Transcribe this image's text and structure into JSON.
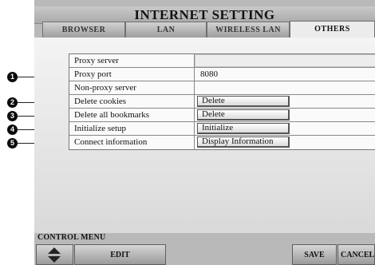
{
  "window": {
    "title": "INTERNET SETTING"
  },
  "tabs": [
    {
      "label": "BROWSER",
      "active": false
    },
    {
      "label": "LAN",
      "active": false
    },
    {
      "label": "WIRELESS LAN",
      "active": false
    },
    {
      "label": "OTHERS",
      "active": true
    }
  ],
  "settings": {
    "proxy_server": {
      "label": "Proxy server",
      "value": ""
    },
    "proxy_port": {
      "label": "Proxy port",
      "value": "8080"
    },
    "non_proxy_server": {
      "label": "Non-proxy server",
      "value": ""
    },
    "delete_cookies": {
      "label": "Delete cookies",
      "button": "Delete"
    },
    "delete_bookmarks": {
      "label": "Delete all bookmarks",
      "button": "Delete"
    },
    "initialize_setup": {
      "label": "Initialize setup",
      "button": "Initialize"
    },
    "connect_info": {
      "label": "Connect information",
      "button": "Display Information"
    }
  },
  "callouts": [
    "1",
    "2",
    "3",
    "4",
    "5"
  ],
  "control_menu": {
    "label": "CONTROL MENU",
    "edit": "EDIT",
    "save": "SAVE",
    "cancel": "CANCEL"
  }
}
